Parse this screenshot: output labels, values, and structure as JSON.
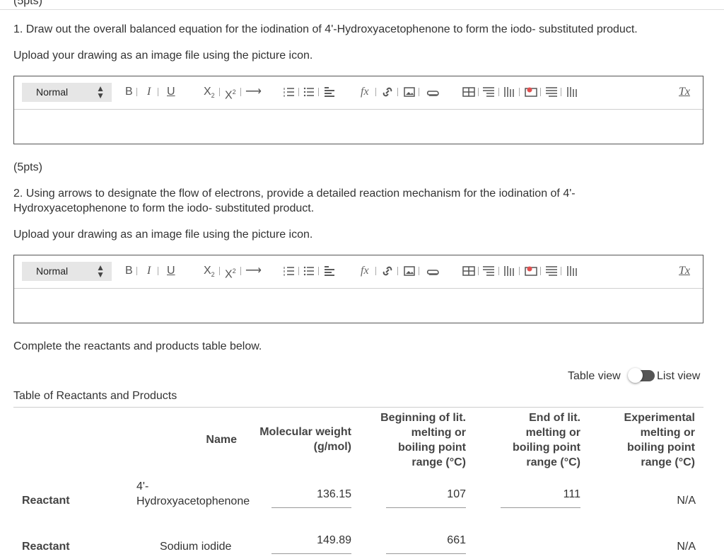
{
  "q_prev_pts": "(5pts)",
  "q1": {
    "text": "1. Draw out the overall balanced equation for the iodination of 4'-Hydroxyacetophenone to form the iodo- substituted product.",
    "upload": "Upload your drawing as an image file using the picture icon."
  },
  "q2": {
    "pts": "(5pts)",
    "line1": "2. Using arrows to designate the flow of electrons, provide a detailed reaction mechanism for the iodination of 4'-",
    "line2": "Hydroxyacetophenone to form the iodo- substituted product.",
    "upload": "Upload your drawing as an image file using the picture icon."
  },
  "editor": {
    "format_value": "Normal",
    "bold": "B",
    "italic": "I",
    "underline": "U",
    "formula": "fx",
    "clear_format": "Tx"
  },
  "complete_text": "Complete the reactants and products table below.",
  "view": {
    "table": "Table view",
    "list": "List view"
  },
  "table": {
    "title": "Table of Reactants and Products",
    "headers": {
      "name": "Name",
      "mw": [
        "Molecular weight",
        "(g/mol)"
      ],
      "begin": [
        "Beginning of lit.",
        "melting or",
        "boiling point",
        "range (°C)"
      ],
      "end": [
        "End of lit.",
        "melting or",
        "boiling point",
        "range (°C)"
      ],
      "exp": [
        "Experimental",
        "melting or",
        "boiling point",
        "range (°C)"
      ]
    },
    "rows": [
      {
        "type": "Reactant",
        "name1": "4'-",
        "name2": "Hydroxyacetophenone",
        "mw": "136.15",
        "begin": "107",
        "end": "111",
        "exp": "N/A"
      },
      {
        "type": "Reactant",
        "name": "Sodium iodide",
        "mw": "149.89",
        "begin": "661",
        "exp": "N/A"
      }
    ]
  }
}
